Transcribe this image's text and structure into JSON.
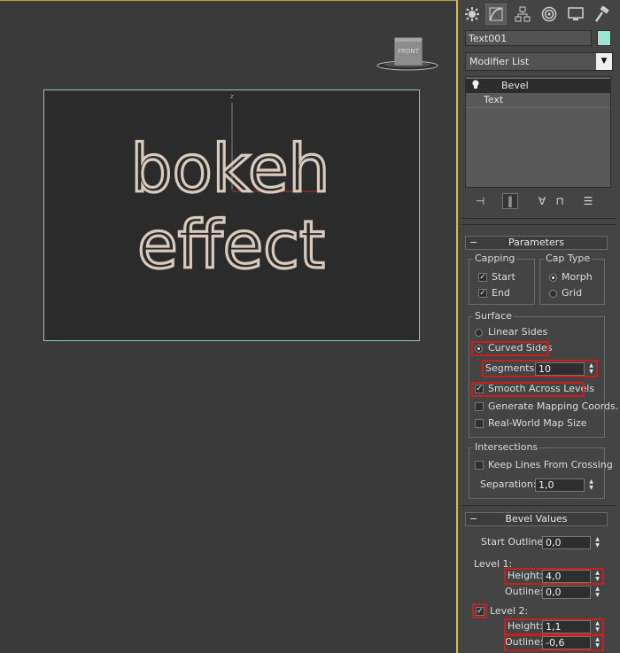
{
  "viewport": {
    "viewcube_label": "FRONT",
    "axis_label": "z",
    "scene_text_lines": [
      "bokeh",
      "effect"
    ]
  },
  "command_panel": {
    "tabs": [
      {
        "name": "create",
        "icon": "sun-gear-icon"
      },
      {
        "name": "modify",
        "icon": "modify-curve-icon"
      },
      {
        "name": "hierarchy",
        "icon": "hierarchy-icon"
      },
      {
        "name": "motion",
        "icon": "motion-circle-icon"
      },
      {
        "name": "display",
        "icon": "display-monitor-icon"
      },
      {
        "name": "utilities",
        "icon": "hammer-icon"
      }
    ],
    "object_name": "Text001",
    "object_color": "#9fe4d2",
    "modifier_list": "Modifier List",
    "stack": [
      {
        "label": "Bevel",
        "selected": true
      },
      {
        "label": "Text",
        "selected": false
      }
    ]
  },
  "parameters": {
    "title": "Parameters",
    "capping": {
      "label": "Capping",
      "start_label": "Start",
      "start_checked": true,
      "end_label": "End",
      "end_checked": true
    },
    "cap_type": {
      "label": "Cap Type",
      "morph_label": "Morph",
      "grid_label": "Grid",
      "selected": "Morph"
    },
    "surface": {
      "label": "Surface",
      "linear_sides_label": "Linear Sides",
      "curved_sides_label": "Curved Sides",
      "selected": "Curved Sides",
      "segments_label": "Segments:",
      "segments_value": "10",
      "smooth_label": "Smooth Across Levels",
      "smooth_checked": true,
      "gen_mapping_label": "Generate Mapping Coords.",
      "gen_mapping_checked": false,
      "real_world_label": "Real-World Map Size",
      "real_world_checked": false
    },
    "intersections": {
      "label": "Intersections",
      "keep_lines_label": "Keep Lines From Crossing",
      "keep_lines_checked": false,
      "separation_label": "Separation:",
      "separation_value": "1,0"
    }
  },
  "bevel_values": {
    "title": "Bevel Values",
    "start_outline_label": "Start Outline:",
    "start_outline_value": "0,0",
    "level1_label": "Level 1:",
    "level1_height_label": "Height:",
    "level1_height_value": "4,0",
    "level1_outline_label": "Outline:",
    "level1_outline_value": "0,0",
    "level2_label": "Level 2:",
    "level2_checked": true,
    "level2_height_label": "Height:",
    "level2_height_value": "1,1",
    "level2_outline_label": "Outline:",
    "level2_outline_value": "-0,6"
  },
  "colors": {
    "highlight": "#c82020",
    "frame": "#8fc6c6",
    "viewport_border": "#d8c03a"
  }
}
